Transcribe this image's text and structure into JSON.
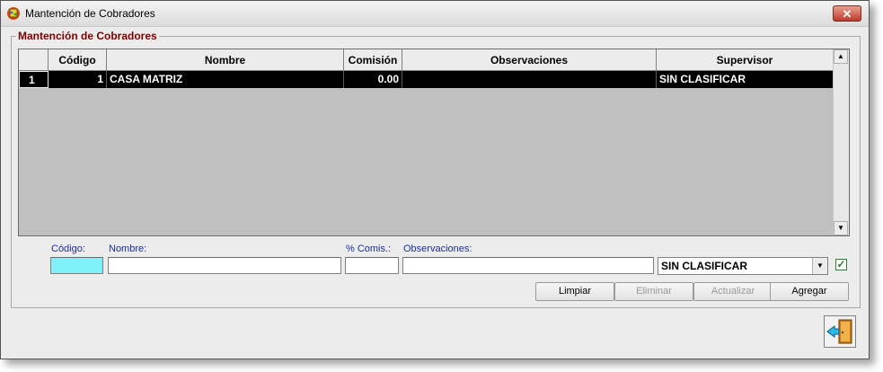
{
  "window": {
    "title": "Mantención de Cobradores",
    "close_label": "✕"
  },
  "group": {
    "title": "Mantención de Cobradores"
  },
  "grid": {
    "columns": [
      "Código",
      "Nombre",
      "Comisión",
      "Observaciones",
      "Supervisor"
    ],
    "rows": [
      {
        "index": "1",
        "codigo": "1",
        "nombre": "CASA MATRIZ",
        "comision": "0.00",
        "observaciones": "",
        "supervisor": "SIN CLASIFICAR"
      }
    ]
  },
  "form": {
    "codigo_label": "Código:",
    "nombre_label": "Nombre:",
    "comis_label": "% Comis.:",
    "observaciones_label": "Observaciones:",
    "supervisor_value": "SIN CLASIFICAR",
    "checkbox_checked": true
  },
  "buttons": {
    "limpiar": "Limpiar",
    "eliminar": "Eliminar",
    "actualizar": "Actualizar",
    "agregar": "Agregar"
  },
  "colors": {
    "title_text": "#800000",
    "label_text": "#1a2fa0",
    "codigo_field_bg": "#7ff0f7",
    "grid_bg": "#c0c0c0",
    "selected_row_bg": "#000000"
  },
  "icons": {
    "app": "app-icon",
    "exit": "exit-door-icon",
    "check": "checkmark-icon"
  }
}
